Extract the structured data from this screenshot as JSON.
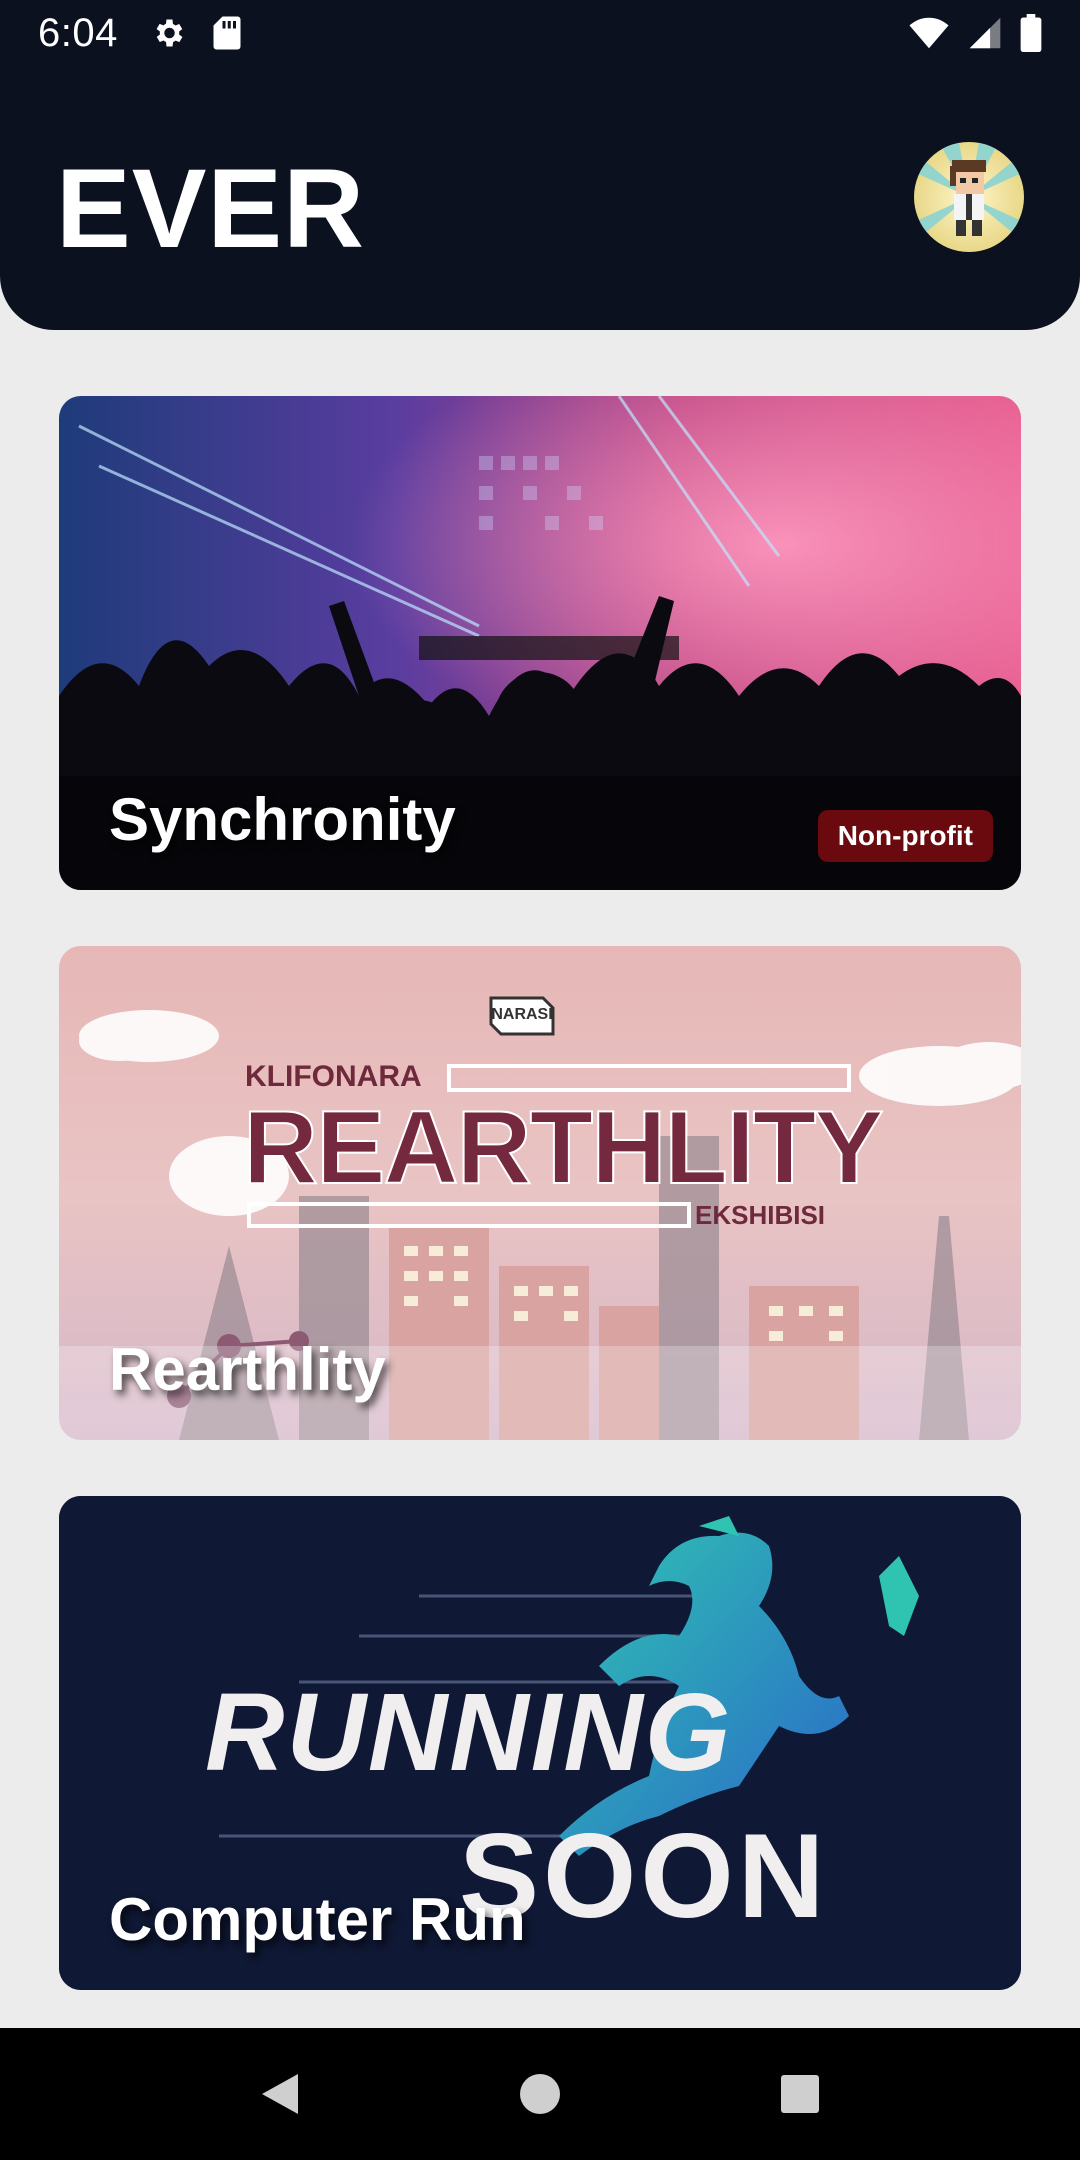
{
  "status_bar": {
    "time": "6:04",
    "left_icons": [
      "gear-icon",
      "sd-card-icon"
    ],
    "right_icons": [
      "wifi-icon",
      "cell-signal-icon",
      "battery-icon"
    ]
  },
  "header": {
    "title": "EVER",
    "avatar_icon": "pixel-avatar"
  },
  "events": [
    {
      "title": "Synchronity",
      "badge": "Non-profit"
    },
    {
      "title": "Rearthlity",
      "poster": {
        "brand": "NARASI",
        "top_line": "KLIFONARA",
        "headline": "REARTHLITY",
        "bottom_line": "EKSHIBISI"
      }
    },
    {
      "title": "Computer Run",
      "poster": {
        "line1": "RUNNING",
        "line2": "SOON"
      }
    }
  ],
  "nav_bar": {
    "buttons": [
      "back-icon",
      "home-icon",
      "recents-icon"
    ]
  },
  "colors": {
    "header_bg": "#0b111e",
    "page_bg": "#ececec",
    "badge_bg": "#6a0a0e",
    "run_card_bg": "#0f1834",
    "run_accent": "#2fc4b2"
  }
}
